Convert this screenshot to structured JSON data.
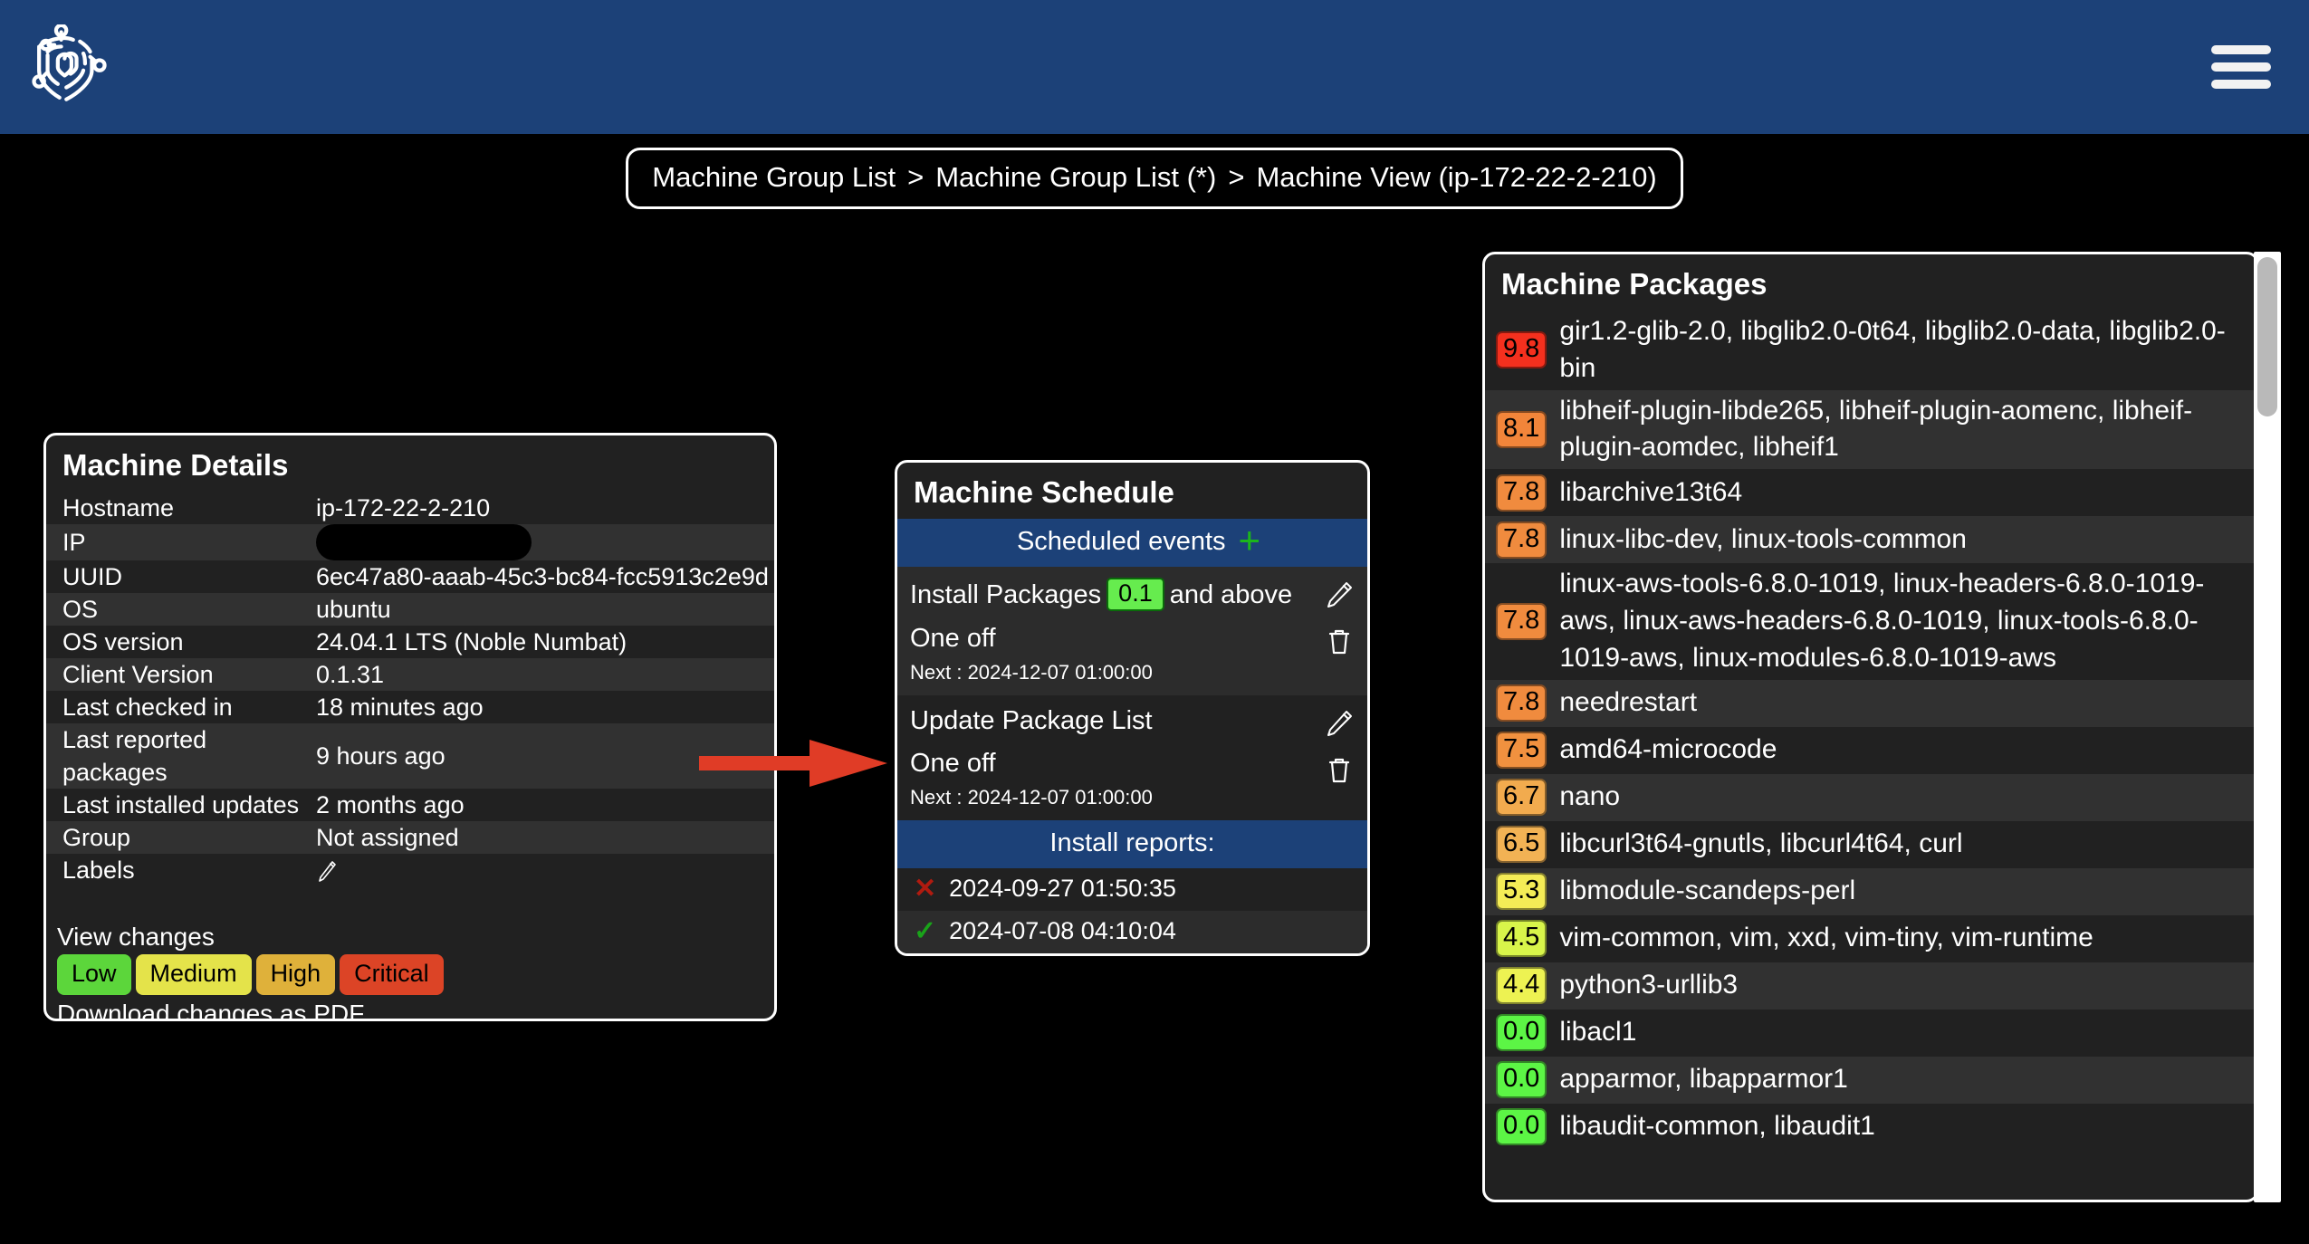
{
  "header": {
    "logo_name": "shield-network-logo",
    "menu_label": "Menu"
  },
  "breadcrumb": {
    "items": [
      "Machine Group List",
      "Machine Group List (*)",
      "Machine View (ip-172-22-2-210)"
    ],
    "separator": ">"
  },
  "machine_details": {
    "title": "Machine Details",
    "rows": [
      {
        "key": "Hostname",
        "value": "ip-172-22-2-210",
        "type": "text"
      },
      {
        "key": "IP",
        "value": "",
        "type": "redacted"
      },
      {
        "key": "UUID",
        "value": "6ec47a80-aaab-45c3-bc84-fcc5913c2e9d",
        "type": "text"
      },
      {
        "key": "OS",
        "value": "ubuntu",
        "type": "text"
      },
      {
        "key": "OS version",
        "value": "24.04.1 LTS (Noble Numbat)",
        "type": "text"
      },
      {
        "key": "Client Version",
        "value": "0.1.31",
        "type": "text"
      },
      {
        "key": "Last checked in",
        "value": "18 minutes ago",
        "type": "text"
      },
      {
        "key": "Last reported packages",
        "value": "9 hours ago",
        "type": "text"
      },
      {
        "key": "Last installed updates",
        "value": "2 months ago",
        "type": "text"
      },
      {
        "key": "Group",
        "value": "Not assigned",
        "type": "text"
      },
      {
        "key": "Labels",
        "value": "",
        "type": "edit-icon"
      }
    ],
    "view_changes_label": "View changes",
    "download_pdf_label": "Download changes as PDF",
    "severities": [
      {
        "label": "Low",
        "color": "#5cd63b"
      },
      {
        "label": "Medium",
        "color": "#e4e34a"
      },
      {
        "label": "High",
        "color": "#dfb13a"
      },
      {
        "label": "Critical",
        "color": "#dc4426"
      }
    ]
  },
  "machine_schedule": {
    "title": "Machine Schedule",
    "scheduled_events_label": "Scheduled events",
    "add_event_icon": "plus-icon",
    "events": [
      {
        "name_prefix": "Install Packages",
        "version_badge": "0.1",
        "name_suffix": "and above",
        "frequency": "One off",
        "next_label": "Next : 2024-12-07 01:00:00"
      },
      {
        "name_prefix": "Update Package List",
        "version_badge": "",
        "name_suffix": "",
        "frequency": "One off",
        "next_label": "Next : 2024-12-07 01:00:00"
      }
    ],
    "install_reports_label": "Install reports:",
    "reports": [
      {
        "status": "fail",
        "mark": "✕",
        "timestamp": "2024-09-27 01:50:35"
      },
      {
        "status": "ok",
        "mark": "✓",
        "timestamp": "2024-07-08 04:10:04"
      }
    ]
  },
  "machine_packages": {
    "title": "Machine Packages",
    "rows": [
      {
        "score": "9.8",
        "color": "#f4301e",
        "packages": "gir1.2-glib-2.0, libglib2.0-0t64, libglib2.0-data, libglib2.0-bin"
      },
      {
        "score": "8.1",
        "color": "#f2853a",
        "packages": "libheif-plugin-libde265, libheif-plugin-aomenc, libheif-plugin-aomdec, libheif1"
      },
      {
        "score": "7.8",
        "color": "#f08b3e",
        "packages": "libarchive13t64"
      },
      {
        "score": "7.8",
        "color": "#f08b3e",
        "packages": "linux-libc-dev, linux-tools-common"
      },
      {
        "score": "7.8",
        "color": "#f08b3e",
        "packages": "linux-aws-tools-6.8.0-1019, linux-headers-6.8.0-1019-aws, linux-aws-headers-6.8.0-1019, linux-tools-6.8.0-1019-aws, linux-modules-6.8.0-1019-aws"
      },
      {
        "score": "7.8",
        "color": "#f08b3e",
        "packages": "needrestart"
      },
      {
        "score": "7.5",
        "color": "#f1913f",
        "packages": "amd64-microcode"
      },
      {
        "score": "6.7",
        "color": "#f2ab4e",
        "packages": "nano"
      },
      {
        "score": "6.5",
        "color": "#f2b254",
        "packages": "libcurl3t64-gnutls, libcurl4t64, curl"
      },
      {
        "score": "5.3",
        "color": "#f4ec56",
        "packages": "libmodule-scandeps-perl"
      },
      {
        "score": "4.5",
        "color": "#d8f54a",
        "packages": "vim-common, vim, xxd, vim-tiny, vim-runtime"
      },
      {
        "score": "4.4",
        "color": "#edf252",
        "packages": "python3-urllib3"
      },
      {
        "score": "0.0",
        "color": "#5cf545",
        "packages": "libacl1"
      },
      {
        "score": "0.0",
        "color": "#5cf545",
        "packages": "apparmor, libapparmor1"
      },
      {
        "score": "0.0",
        "color": "#5cf545",
        "packages": "libaudit-common, libaudit1"
      }
    ]
  },
  "annotation": {
    "arrow_color": "#e03c26",
    "arrow_name": "red-pointer-arrow"
  }
}
